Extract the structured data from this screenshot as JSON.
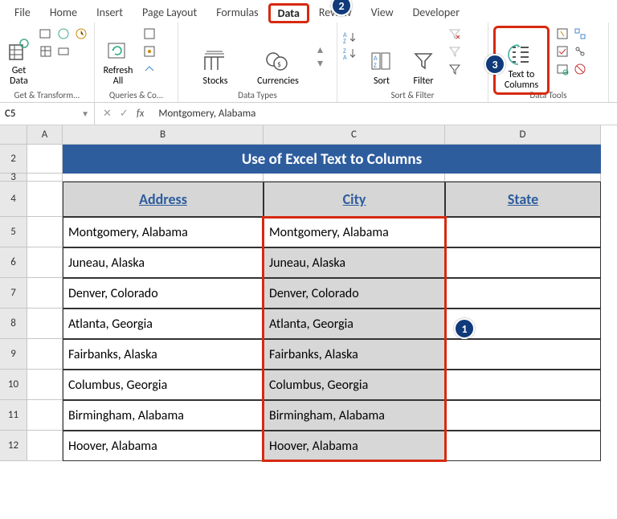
{
  "tabs": [
    "File",
    "Home",
    "Insert",
    "Page Layout",
    "Formulas",
    "Data",
    "Review",
    "View",
    "Developer"
  ],
  "active_tab_index": 5,
  "ribbon": {
    "groups": [
      {
        "label": "Get & Transform...",
        "buttons": {
          "get_data": "Get\nData"
        }
      },
      {
        "label": "Queries & Co...",
        "buttons": {
          "refresh_all": "Refresh\nAll"
        }
      },
      {
        "label": "Data Types",
        "buttons": {
          "stocks": "Stocks",
          "currencies": "Currencies"
        }
      },
      {
        "label": "Sort & Filter",
        "buttons": {
          "sort": "Sort",
          "filter": "Filter"
        }
      },
      {
        "label": "Data Tools",
        "buttons": {
          "text_to_columns": "Text to\nColumns"
        }
      }
    ]
  },
  "callouts": {
    "step1": "1",
    "step2": "2",
    "step3": "3"
  },
  "namebox": "C5",
  "formula": "Montgomery, Alabama",
  "columns": [
    "A",
    "B",
    "C",
    "D"
  ],
  "rows": [
    "2",
    "3",
    "4",
    "5",
    "6",
    "7",
    "8",
    "9",
    "10",
    "11",
    "12"
  ],
  "sheet": {
    "title": "Use of Excel Text to Columns",
    "headers": [
      "Address",
      "City",
      "State"
    ],
    "data": [
      [
        "Montgomery, Alabama",
        "Montgomery, Alabama",
        ""
      ],
      [
        "Juneau, Alaska",
        "Juneau, Alaska",
        ""
      ],
      [
        "Denver, Colorado",
        "Denver, Colorado",
        ""
      ],
      [
        "Atlanta, Georgia",
        "Atlanta, Georgia",
        ""
      ],
      [
        "Fairbanks, Alaska",
        "Fairbanks, Alaska",
        ""
      ],
      [
        "Columbus, Georgia",
        "Columbus, Georgia",
        ""
      ],
      [
        "Birmingham, Alabama",
        "Birmingham, Alabama",
        ""
      ],
      [
        "Hoover, Alabama",
        "Hoover, Alabama",
        ""
      ]
    ]
  },
  "colors": {
    "accent": "#2e5d9e",
    "highlight": "#d62a10",
    "callout": "#103a7a"
  }
}
